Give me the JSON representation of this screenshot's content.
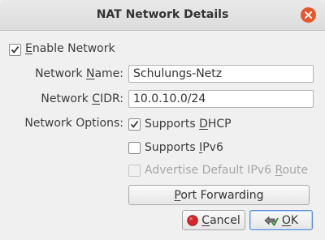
{
  "window": {
    "title": "NAT Network Details",
    "close_icon": "close-icon"
  },
  "enable_network": {
    "checked": true,
    "label_key": "E",
    "label_rest": "nable Network"
  },
  "fields": {
    "name": {
      "label_pre": "Network ",
      "label_key": "N",
      "label_post": "ame:",
      "value": "Schulungs-Netz"
    },
    "cidr": {
      "label_pre": "Network ",
      "label_key": "C",
      "label_post": "IDR:",
      "value": "10.0.10.0/24"
    },
    "options_label": "Network Options:"
  },
  "options": {
    "dhcp": {
      "checked": true,
      "label_pre": "Supports ",
      "label_key": "D",
      "label_post": "HCP"
    },
    "ipv6": {
      "checked": false,
      "label_pre": "Supports ",
      "label_key": "I",
      "label_post": "Pv6"
    },
    "ipv6_route": {
      "checked": false,
      "disabled": true,
      "label_pre": "Advertise Default IPv6 ",
      "label_key": "R",
      "label_post": "oute"
    }
  },
  "buttons": {
    "port_forwarding": {
      "label_key": "P",
      "label_rest": "ort Forwarding"
    },
    "cancel": {
      "label_key": "C",
      "label_rest": "ancel",
      "icon": "cancel-icon"
    },
    "ok": {
      "label_key": "O",
      "label_rest": "K",
      "icon": "ok-icon"
    }
  },
  "colors": {
    "close_button": "#e8572b",
    "cancel_icon": "#d8262b",
    "focus_border": "#5b8fd6"
  }
}
